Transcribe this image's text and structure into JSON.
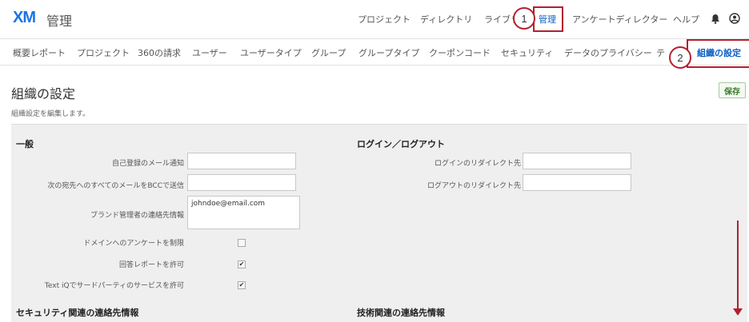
{
  "header": {
    "logo": "XM",
    "title": "管理",
    "nav": [
      "プロジェクト",
      "ディレクトリ",
      "ライブラ",
      "管理",
      "アンケートディレクター",
      "ヘルプ"
    ],
    "icons": [
      "bell-icon",
      "user-icon"
    ]
  },
  "subnav": {
    "items": [
      "概要レポート",
      "プロジェクト",
      "360の請求",
      "ユーザー",
      "ユーザータイプ",
      "グループ",
      "グループタイプ",
      "クーポンコード",
      "セキュリティ",
      "データのプライバシー",
      "テ",
      "組織の設定"
    ],
    "active": "組織の設定"
  },
  "callouts": [
    "1",
    "2"
  ],
  "page": {
    "title": "組織の設定",
    "subtitle": "組織設定を編集します。",
    "save": "保存"
  },
  "general": {
    "title": "一般",
    "fields": {
      "self_register_label": "自己登録のメール通知",
      "bcc_label": "次の宛先へのすべてのメールをBCCで送信",
      "brand_admin_label": "ブランド管理者の連絡先情報",
      "brand_admin_value": "johndoe@email.com",
      "restrict_label": "ドメインへのアンケートを制限",
      "restrict_checked": false,
      "response_label": "回答レポートを許可",
      "response_checked": true,
      "textiq_label": "Text iQでサードパーティのサービスを許可",
      "textiq_checked": true
    }
  },
  "login": {
    "title": "ログイン／ログアウト",
    "login_redirect_label": "ログインのリダイレクト先",
    "logout_redirect_label": "ログアウトのリダイレクト先"
  },
  "security_contact": {
    "title": "セキュリティ関連の連絡先情報"
  },
  "tech_contact": {
    "title": "技術関連の連絡先情報"
  },
  "check_mark": "✔"
}
